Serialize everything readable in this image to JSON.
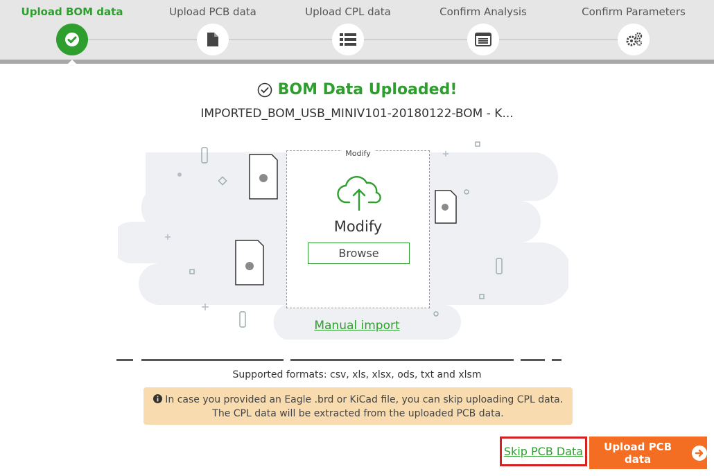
{
  "steps": [
    {
      "label": "Upload BOM data",
      "icon": "check-icon",
      "active": true
    },
    {
      "label": "Upload PCB data",
      "icon": "file-icon"
    },
    {
      "label": "Upload CPL data",
      "icon": "list-icon"
    },
    {
      "label": "Confirm Analysis",
      "icon": "window-list-icon"
    },
    {
      "label": "Confirm Parameters",
      "icon": "gears-icon"
    }
  ],
  "main": {
    "title": "BOM Data Uploaded!",
    "filename": "IMPORTED_BOM_USB_MINIV101-20180122-BOM - K...",
    "dropzone": {
      "legend": "Modify",
      "label": "Modify",
      "browse": "Browse"
    },
    "manual_import": "Manual import",
    "formats": "Supported formats: csv, xls, xlsx, ods, txt and xlsm",
    "notice_line1": "In case you provided an Eagle .brd or KiCad file, you can skip uploading CPL data.",
    "notice_line2": "The CPL data will be extracted from the uploaded PCB data."
  },
  "actions": {
    "skip": "Skip PCB Data",
    "upload": "Upload PCB data"
  },
  "colors": {
    "accent_green": "#2e9e2e",
    "action_orange": "#f36d23",
    "notice_bg": "#f8dcb0",
    "highlight_red": "#d42020"
  }
}
